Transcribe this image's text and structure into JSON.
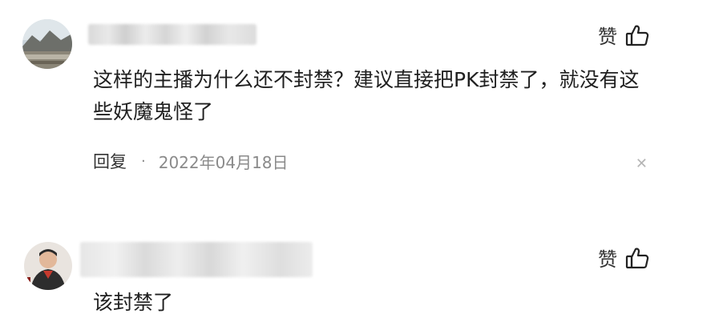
{
  "comments": [
    {
      "like_label": "赞",
      "text": "这样的主播为什么还不封禁？建议直接把PK封禁了，就没有这些妖魔鬼怪了",
      "reply_label": "回复",
      "separator": "·",
      "date": "2022年04月18日",
      "icons": {
        "like": "thumbs-up-icon",
        "close": "close-icon"
      }
    },
    {
      "like_label": "赞",
      "text": "该封禁了",
      "icons": {
        "like": "thumbs-up-icon"
      }
    }
  ],
  "colors": {
    "text": "#1f1f1f",
    "date": "#8a8a8a",
    "close": "#b5b5b5"
  }
}
